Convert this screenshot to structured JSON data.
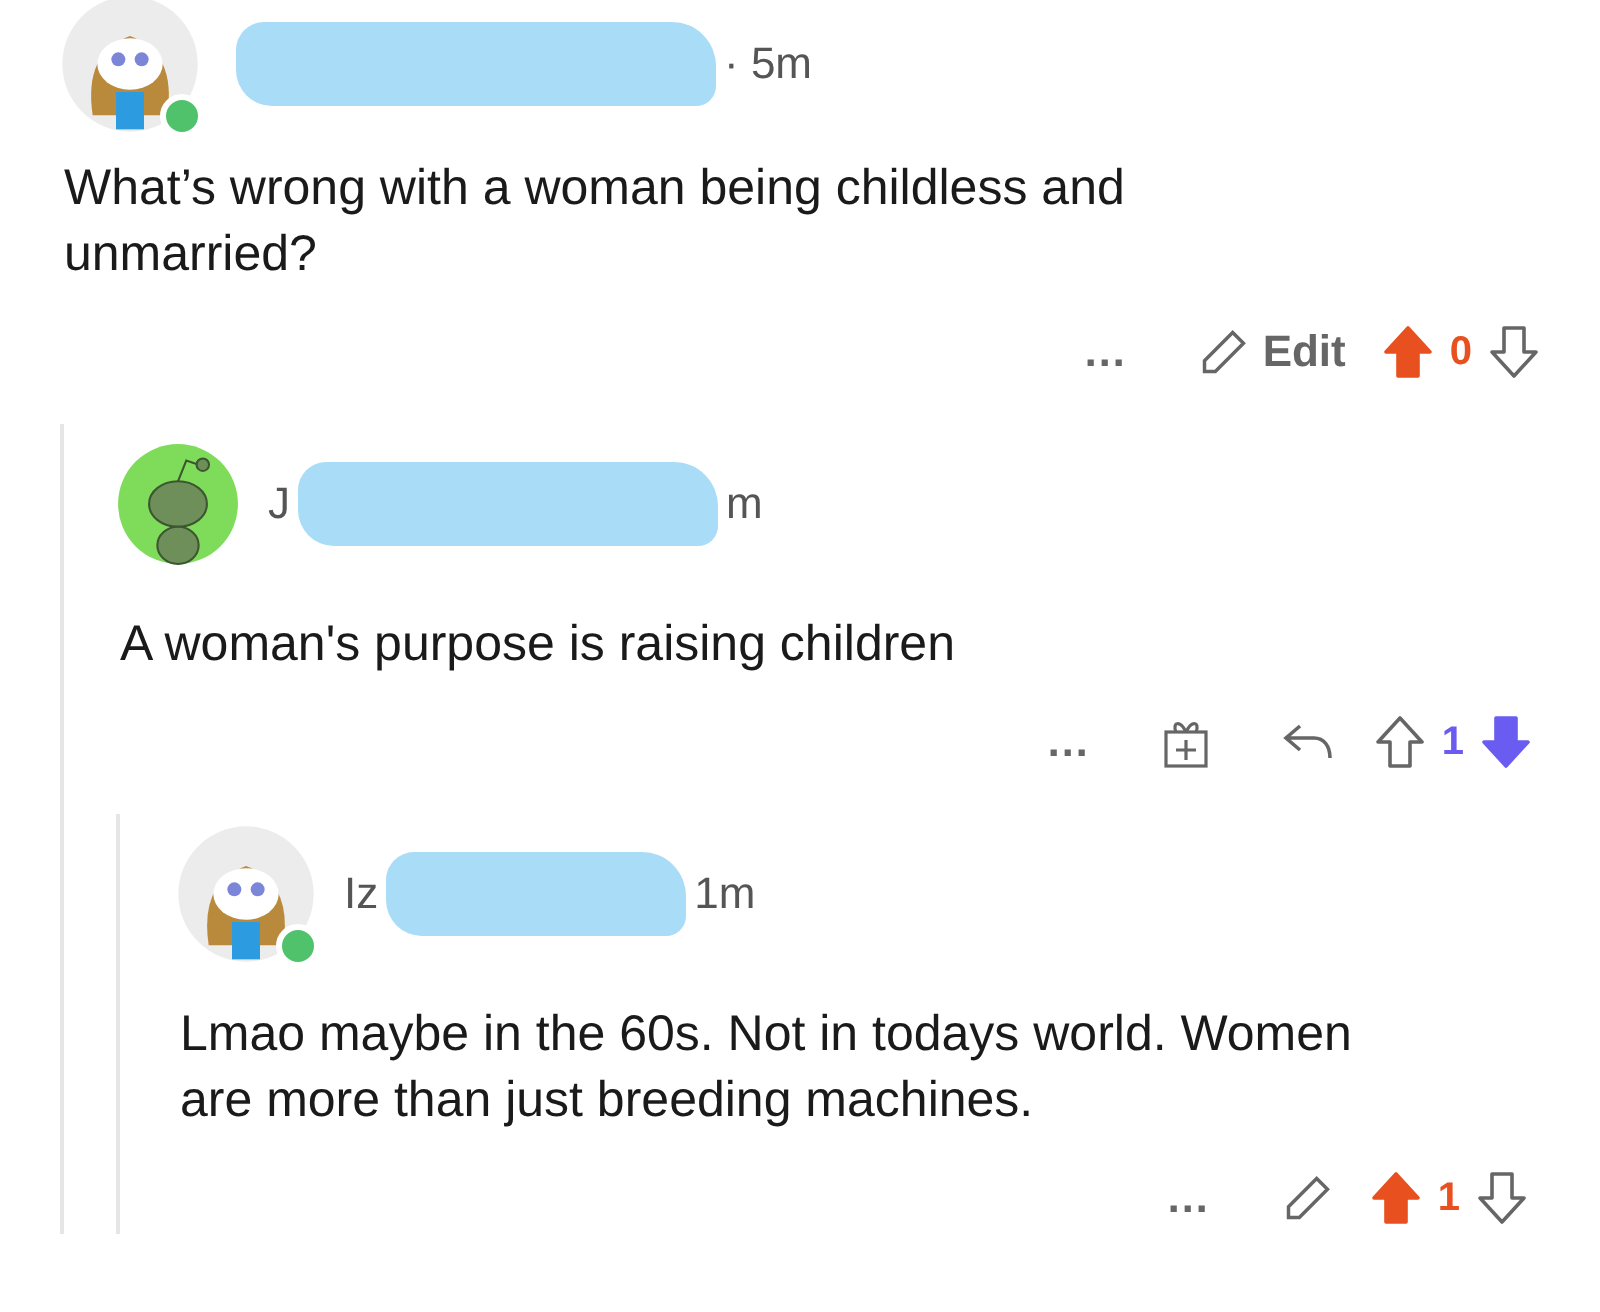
{
  "comments": [
    {
      "kind": "own",
      "online": true,
      "time_fragment": "· 5m",
      "body": "What’s wrong with a woman being childless and unmarried?",
      "actions": [
        {
          "kind": "more",
          "label": "…"
        },
        {
          "kind": "edit",
          "label": "Edit"
        }
      ],
      "score": "0",
      "upvoted": true,
      "downvoted": false,
      "children": [
        {
          "kind": "other",
          "author_fragment": "J",
          "time_fragment": "m",
          "body": "A woman's purpose is raising children",
          "actions": [
            {
              "kind": "more",
              "label": "…"
            },
            {
              "kind": "award"
            },
            {
              "kind": "reply"
            }
          ],
          "score": "1",
          "upvoted": false,
          "downvoted": true,
          "children": [
            {
              "kind": "own",
              "online": true,
              "author_fragment": "Iz",
              "time_fragment": "1m",
              "body": "Lmao maybe in the 60s. Not in todays world. Women are more than just breeding machines.",
              "actions": [
                {
                  "kind": "more",
                  "label": "…"
                },
                {
                  "kind": "edit"
                }
              ],
              "score": "1",
              "upvoted": true,
              "downvoted": false
            }
          ]
        }
      ]
    }
  ]
}
